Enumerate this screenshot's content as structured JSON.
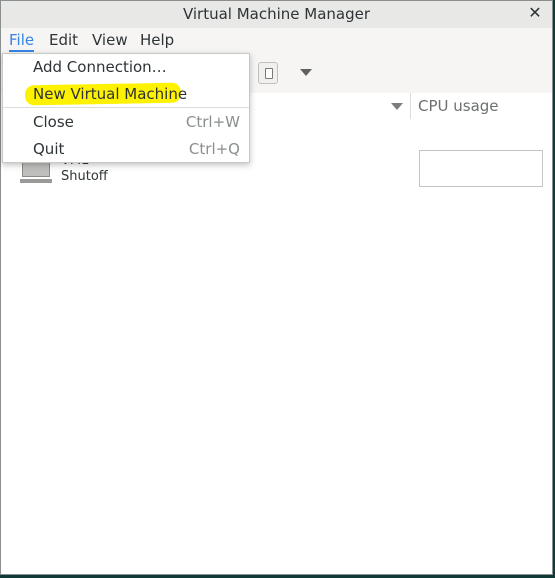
{
  "window": {
    "title": "Virtual Machine Manager"
  },
  "menubar": {
    "file": "File",
    "edit": "Edit",
    "view": "View",
    "help": "Help"
  },
  "file_menu": {
    "items": [
      {
        "label": "Add Connection…",
        "accel": ""
      },
      {
        "label": "New Virtual Machine",
        "accel": ""
      },
      {
        "label": "Close",
        "accel": "Ctrl+W"
      },
      {
        "label": "Quit",
        "accel": "Ctrl+Q"
      }
    ]
  },
  "columns": {
    "cpu": "CPU usage"
  },
  "vms": [
    {
      "name": "VM1",
      "state": "Shutoff"
    }
  ],
  "colors": {
    "highlight": "#fff200",
    "accent": "#3584e4"
  },
  "icons": {
    "close": "close-icon",
    "vm": "monitor-icon",
    "toolbar_button": "delete-icon",
    "dropdown": "chevron-down-icon"
  }
}
